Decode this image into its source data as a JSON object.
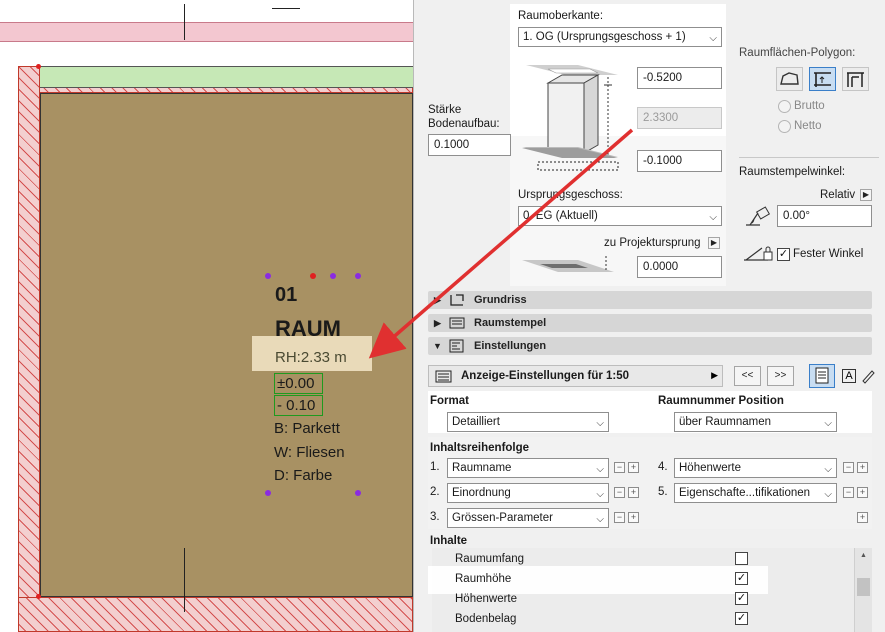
{
  "stamp": {
    "number": "01",
    "name": "RAUM",
    "height_line": "RH:2.33 m",
    "level_top": "±0.00",
    "level_bottom": "- 0.10",
    "floor": "B: Parkett",
    "wall": "W: Fliesen",
    "ceiling": "D: Farbe"
  },
  "top_panel": {
    "upper_edge_label": "Raumoberkante:",
    "upper_edge_value": "1. OG (Ursprungsgeschoss + 1)",
    "offset_top": "-0.5200",
    "height_value": "2.3300",
    "offset_bottom": "-0.1000",
    "floor_thickness_label_1": "Stärke",
    "floor_thickness_label_2": "Bodenaufbau:",
    "floor_thickness_value": "0.1000",
    "origin_story_label": "Ursprungsgeschoss:",
    "origin_story_value": "0. EG (Aktuell)",
    "project_zero_label": "zu Projektursprung",
    "project_zero_value": "0.0000"
  },
  "polygon": {
    "label": "Raumflächen-Polygon:",
    "gross": "Brutto",
    "net": "Netto"
  },
  "stamp_angle": {
    "label": "Raumstempelwinkel:",
    "mode": "Relativ",
    "value": "0.00°",
    "fixed_label": "Fester Winkel"
  },
  "sections": {
    "floor_plan": "Grundriss",
    "room_stamp": "Raumstempel",
    "settings": "Einstellungen"
  },
  "display_settings": {
    "label": "Anzeige-Einstellungen für 1:50",
    "prev": "<<",
    "next": ">>"
  },
  "format": {
    "label": "Format",
    "value": "Detailliert",
    "position_label": "Raumnummer Position",
    "position_value": "über Raumnamen"
  },
  "content_order": {
    "label": "Inhaltsreihenfolge",
    "items": [
      {
        "num": "1.",
        "value": "Raumname"
      },
      {
        "num": "2.",
        "value": "Einordnung"
      },
      {
        "num": "3.",
        "value": "Grössen-Parameter"
      },
      {
        "num": "4.",
        "value": "Höhenwerte"
      },
      {
        "num": "5.",
        "value": "Eigenschafte...tifikationen"
      }
    ]
  },
  "contents": {
    "label": "Inhalte",
    "rows": [
      {
        "label": "Raumumfang",
        "checked": ""
      },
      {
        "label": "Raumhöhe",
        "checked": "✓"
      },
      {
        "label": "Höhenwerte",
        "checked": "✓"
      },
      {
        "label": "Bodenbelag",
        "checked": "✓"
      }
    ]
  },
  "colors": {
    "room_fill": "#a89163",
    "hatch_red": "#d44f4f",
    "arrow_red": "#e03030",
    "highlight": "#f5e6c8"
  }
}
